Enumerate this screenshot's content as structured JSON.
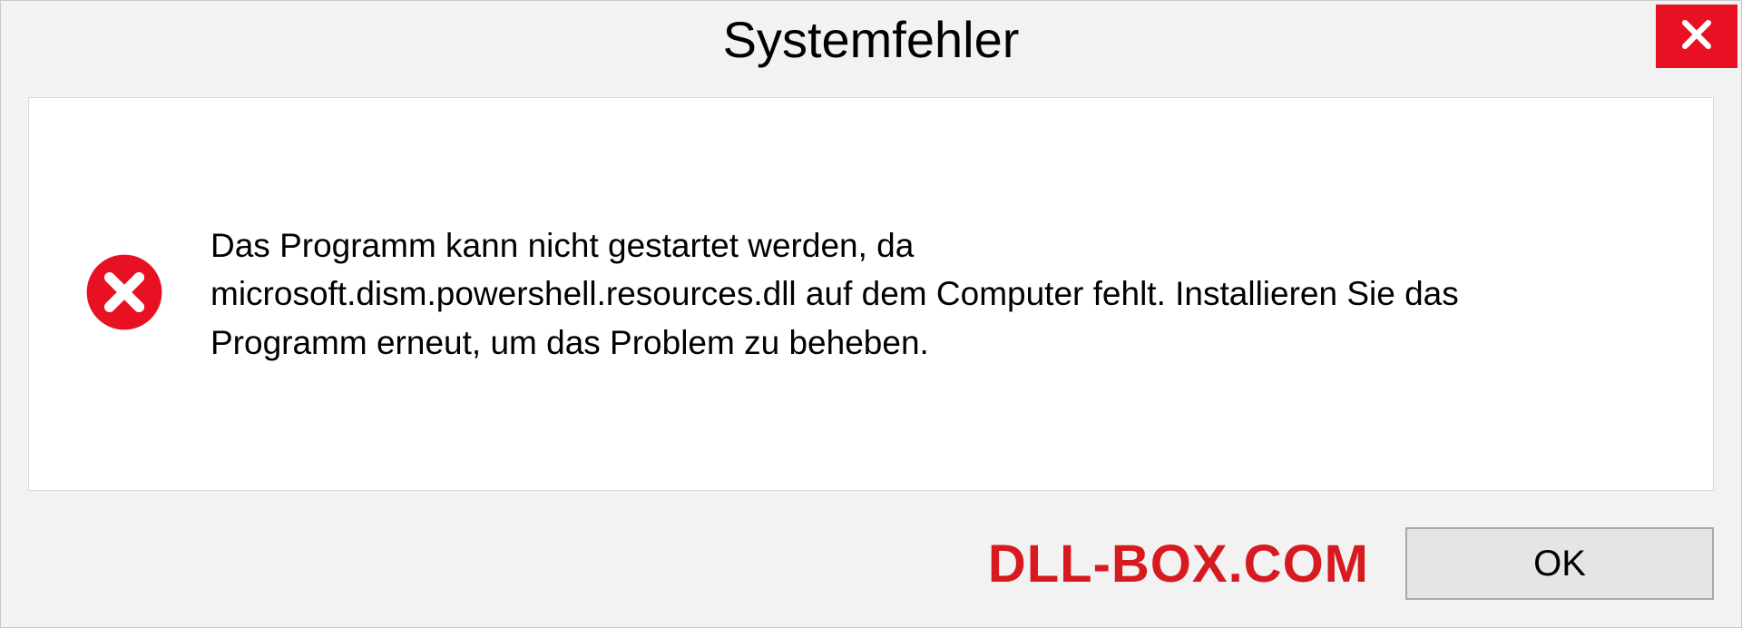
{
  "dialog": {
    "title": "Systemfehler",
    "message": "Das Programm kann nicht gestartet werden, da microsoft.dism.powershell.resources.dll auf dem Computer fehlt. Installieren Sie das Programm erneut, um das Problem zu beheben.",
    "ok_label": "OK"
  },
  "watermark": "DLL-BOX.COM",
  "colors": {
    "close_bg": "#e81123",
    "error_icon": "#e81123",
    "watermark": "#d61a1f"
  }
}
